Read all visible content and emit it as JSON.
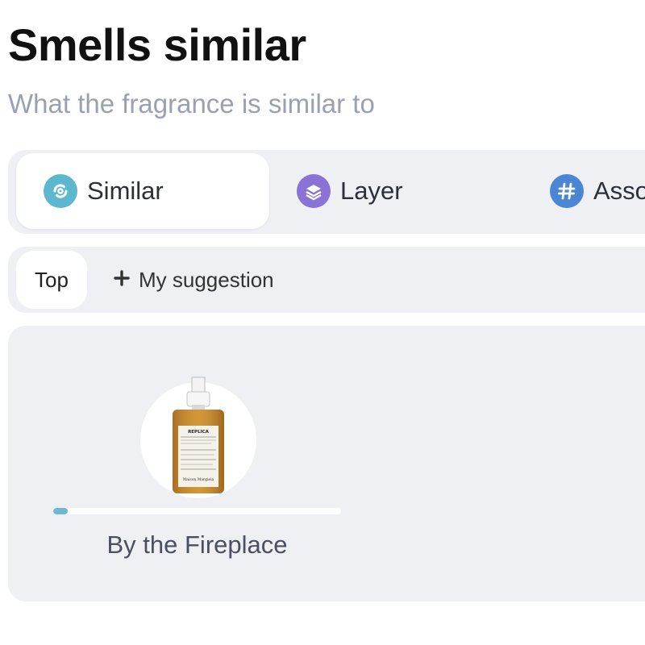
{
  "header": {
    "title": "Smells similar",
    "subtitle": "What the fragrance is similar to"
  },
  "tabs": [
    {
      "label": "Similar",
      "icon": "similar-icon",
      "active": true
    },
    {
      "label": "Layer",
      "icon": "layers-icon",
      "active": false
    },
    {
      "label": "Asso",
      "icon": "hash-icon",
      "active": false
    }
  ],
  "filters": {
    "top_label": "Top",
    "suggestion_label": "My suggestion",
    "suggestion_icon": "plus-icon"
  },
  "results": [
    {
      "name": "By the Fireplace",
      "image": "perfume-bottle-image",
      "bottle_label": {
        "brand": "REPLICA",
        "maker": "Maison Margiela"
      },
      "vote_fraction": 0.05
    }
  ],
  "colors": {
    "similar": "#5db7cf",
    "layer": "#8a72d6",
    "association": "#4a86d4",
    "progress": "#6fb8cf"
  }
}
